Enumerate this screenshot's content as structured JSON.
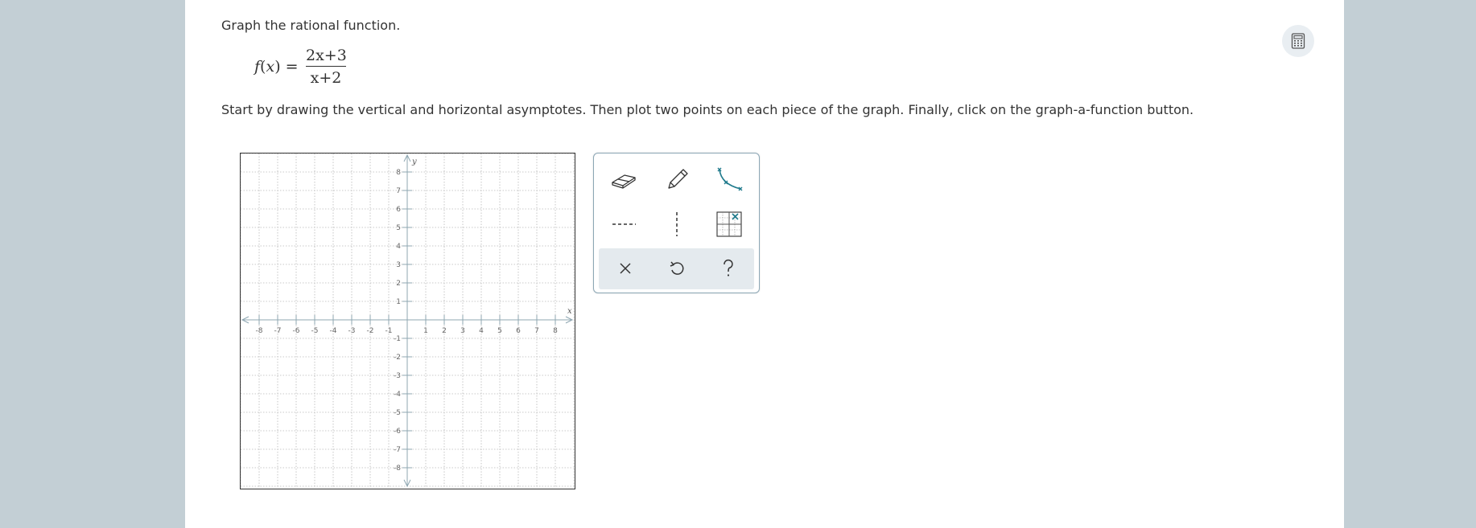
{
  "instructions": {
    "line1": "Graph the rational function.",
    "line2": "Start by drawing the vertical and horizontal asymptotes. Then plot two points on each piece of the graph. Finally, click on the graph-a-function button."
  },
  "equation": {
    "lhs": "f",
    "arg": "x",
    "numerator": "2x+3",
    "denominator": "x+2"
  },
  "graph": {
    "x_axis_label": "x",
    "y_axis_label": "y",
    "xlim": [
      -9,
      9
    ],
    "ylim": [
      -9,
      9
    ],
    "x_ticks": [
      "-8",
      "-7",
      "-6",
      "-5",
      "-4",
      "-3",
      "-2",
      "-1",
      "1",
      "2",
      "3",
      "4",
      "5",
      "6",
      "7",
      "8"
    ],
    "y_ticks": [
      "8",
      "7",
      "6",
      "5",
      "4",
      "3",
      "2",
      "1",
      "-1",
      "-2",
      "-3",
      "-4",
      "-5",
      "-6",
      "-7",
      "-8"
    ],
    "grid": true
  },
  "toolbox": {
    "tools": [
      "eraser-icon",
      "pencil-icon",
      "curve-graph-icon",
      "horizontal-asymptote-icon",
      "vertical-asymptote-icon",
      "point-grid-icon"
    ],
    "actions": [
      "clear-icon",
      "undo-icon",
      "help-icon"
    ]
  },
  "colors": {
    "accent": "#1f7a8c",
    "background": "#c3cfd5",
    "panel": "#ffffff"
  }
}
